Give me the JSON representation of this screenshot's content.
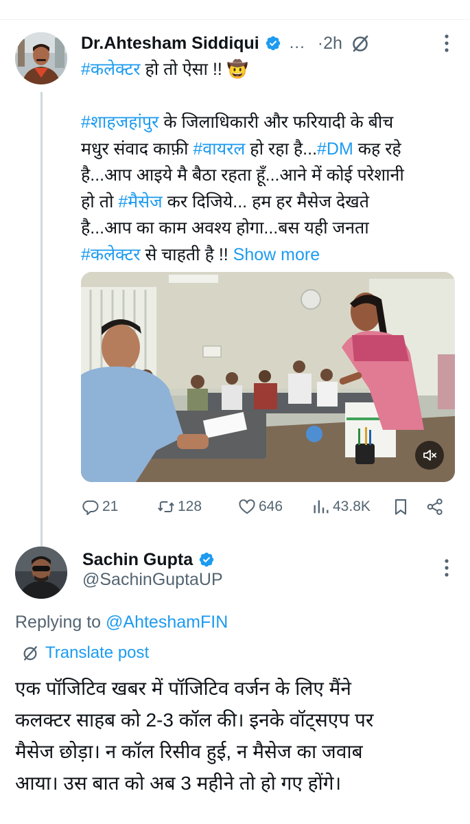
{
  "tweet1": {
    "author_name": "Dr.Ahtesham Siddiqui",
    "ellipsis": "...",
    "time": "·2h",
    "lines": [
      [
        {
          "t": "#कलेक्टर",
          "tag": true
        },
        {
          "t": " हो तो ऐसा !! 🤠",
          "tag": false
        }
      ],
      [],
      [
        {
          "t": "#शाहजहांपुर",
          "tag": true
        },
        {
          "t": " के जिलाधिकारी और फरियादी के बीच",
          "tag": false
        }
      ],
      [
        {
          "t": "मधुर संवाद काफ़ी ",
          "tag": false
        },
        {
          "t": "#वायरल",
          "tag": true
        },
        {
          "t": " हो रहा है...",
          "tag": false
        },
        {
          "t": "#DM",
          "tag": true
        },
        {
          "t": " कह रहे",
          "tag": false
        }
      ],
      [
        {
          "t": "है...आप आइये मै बैठा रहता हूँ...आने में कोई परेशानी",
          "tag": false
        }
      ],
      [
        {
          "t": "हो तो ",
          "tag": false
        },
        {
          "t": "#मैसेज",
          "tag": true
        },
        {
          "t": " कर दिजिये... हम हर मैसेज देखते",
          "tag": false
        }
      ],
      [
        {
          "t": "है...आप का काम अवश्य होगा...बस यही जनता",
          "tag": false
        }
      ],
      [
        {
          "t": "#कलेक्टर",
          "tag": true
        },
        {
          "t": " से चाहती है !! ",
          "tag": false
        },
        {
          "t": "Show more",
          "tag": true
        }
      ]
    ],
    "media_alt": "video-still",
    "stats": {
      "replies": "21",
      "reposts": "128",
      "likes": "646",
      "views": "43.8K"
    }
  },
  "tweet2": {
    "author_name": "Sachin Gupta",
    "handle": "@SachinGuptaUP",
    "replying_prefix": "Replying to ",
    "replying_to": "@AhteshamFIN",
    "translate_label": "Translate post",
    "lines": [
      "एक पॉजिटिव खबर में पॉजिटिव वर्जन के लिए मैंने",
      "कलक्टर साहब को 2-3 कॉल की। इनके वॉट्सएप पर",
      "मैसेज छोड़ा। न कॉल रिसीव हुई, न मैसेज का जवाब",
      "आया। उस बात को अब 3 महीने तो हो गए होंगे।"
    ]
  },
  "colors": {
    "accent": "#1d9bf0",
    "text": "#0f1419",
    "muted": "#536471",
    "thread": "#cfd9de"
  }
}
